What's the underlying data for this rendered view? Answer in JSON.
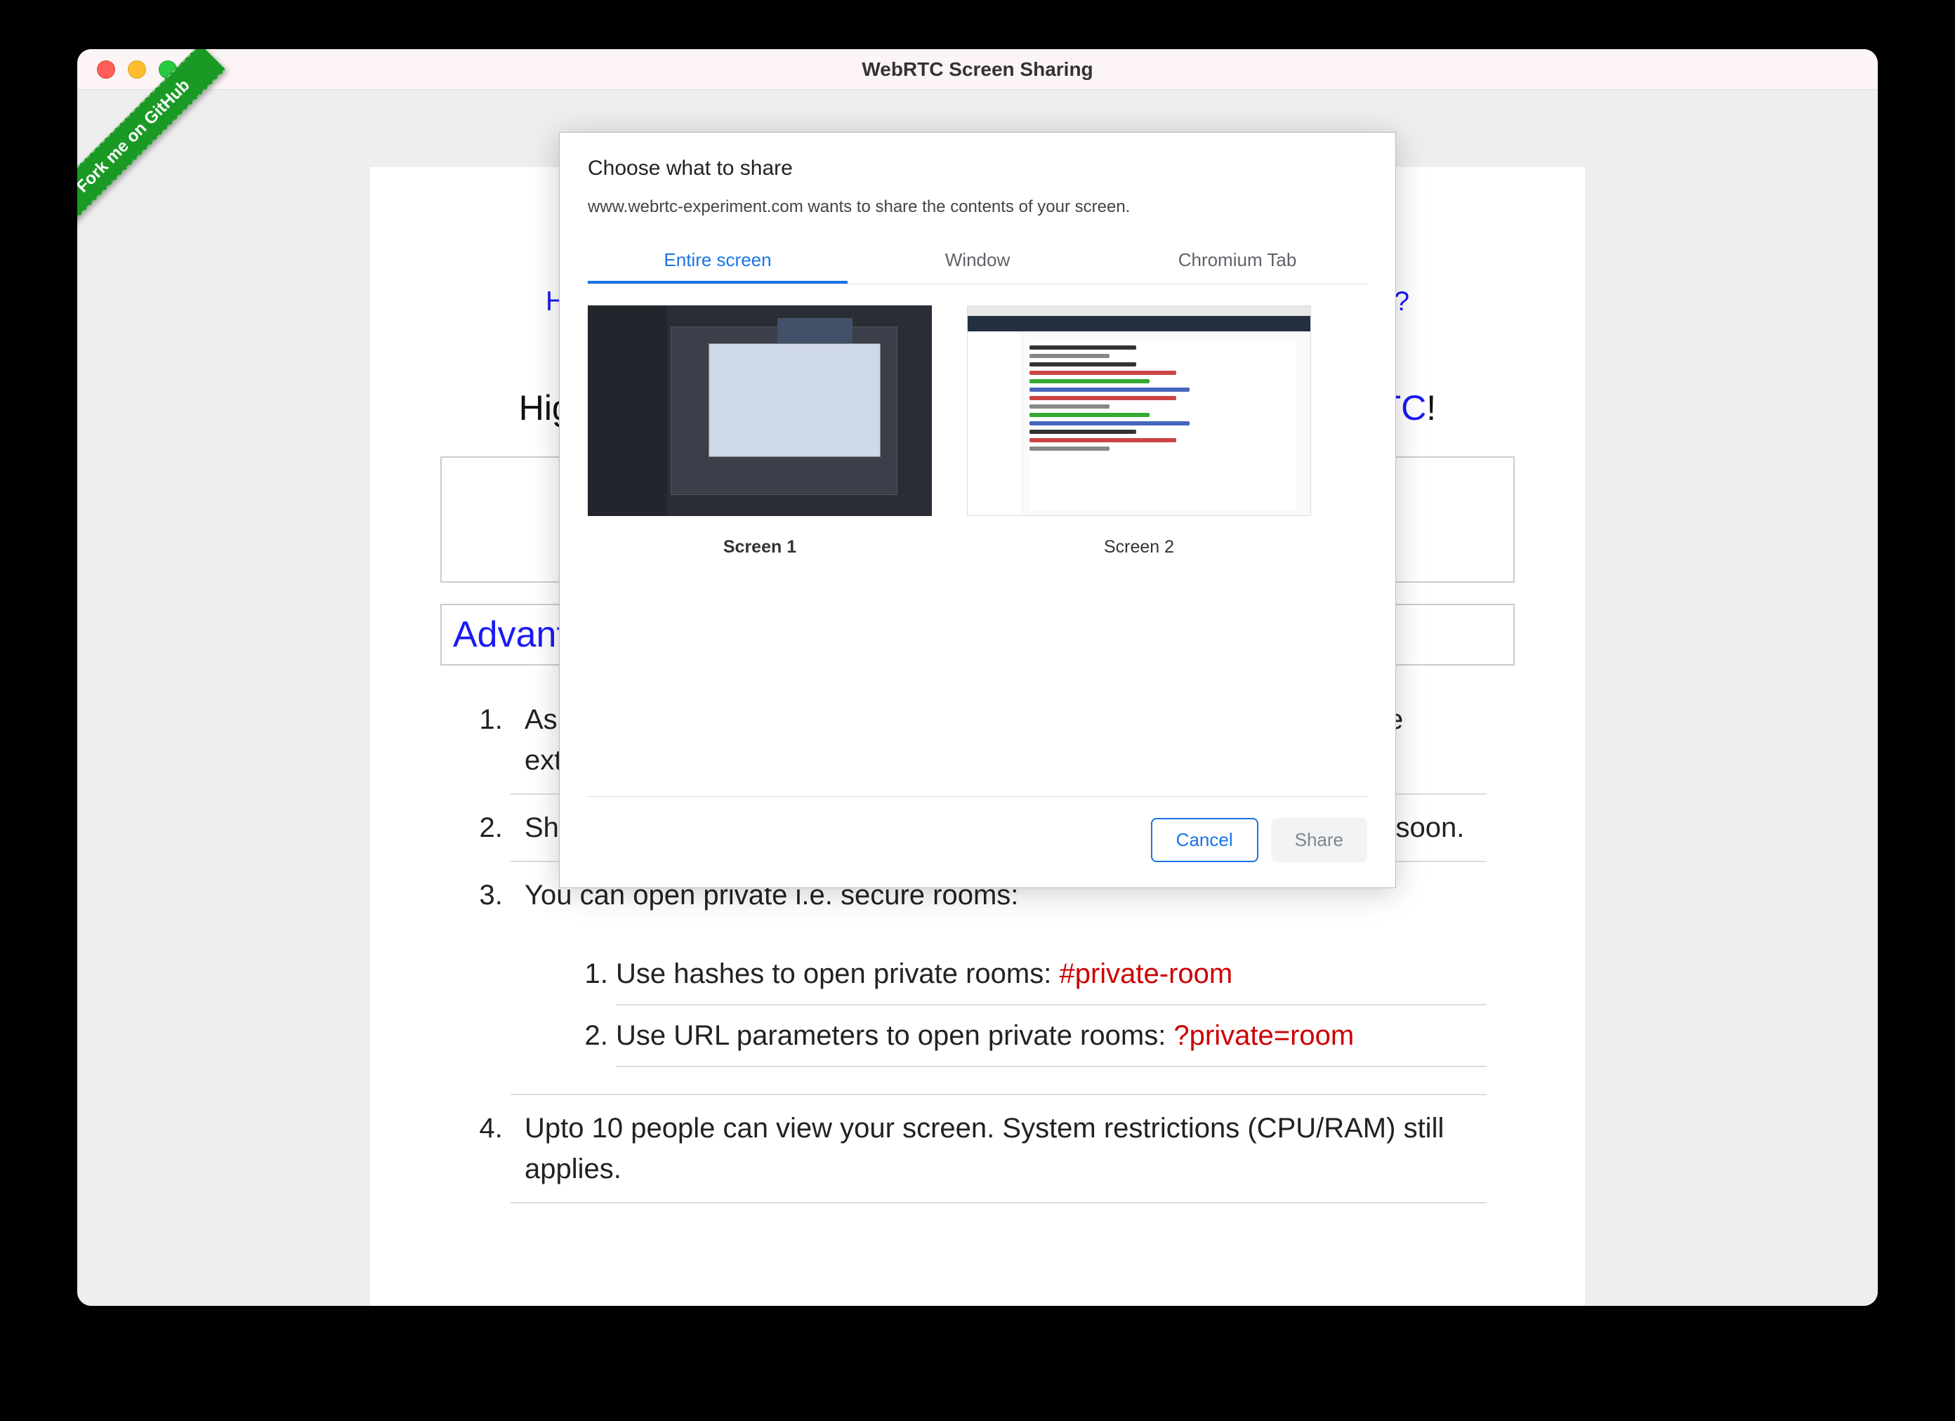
{
  "window_title": "WebRTC Screen Sharing",
  "ribbon": "Fork me on GitHub",
  "toplinks_left": "HO",
  "toplinks_right": "w?",
  "headline_left": "High",
  "headline_blue": "RTC",
  "headline_bang": "!",
  "section_title": "Advant",
  "advantages": [
    "As",
    "Share screen from Chrome, Firefox or Edge. Safari support is coming soon.",
    "You can open private i.e. secure rooms:",
    "Upto 10 people can view your screen. System restrictions (CPU/RAM) still applies."
  ],
  "adv1_line2": "extension! No Firefox addon!",
  "adv1_tail": "e",
  "private_rooms": [
    {
      "pre": "Use hashes to open private rooms: ",
      "red": "#private-room"
    },
    {
      "pre": "Use URL parameters to open private rooms: ",
      "red": "?private=room"
    }
  ],
  "dialog": {
    "title": "Choose what to share",
    "subtitle": "www.webrtc-experiment.com wants to share the contents of your screen.",
    "tabs": [
      "Entire screen",
      "Window",
      "Chromium Tab"
    ],
    "screen1": "Screen 1",
    "screen2": "Screen 2",
    "cancel": "Cancel",
    "share": "Share"
  }
}
